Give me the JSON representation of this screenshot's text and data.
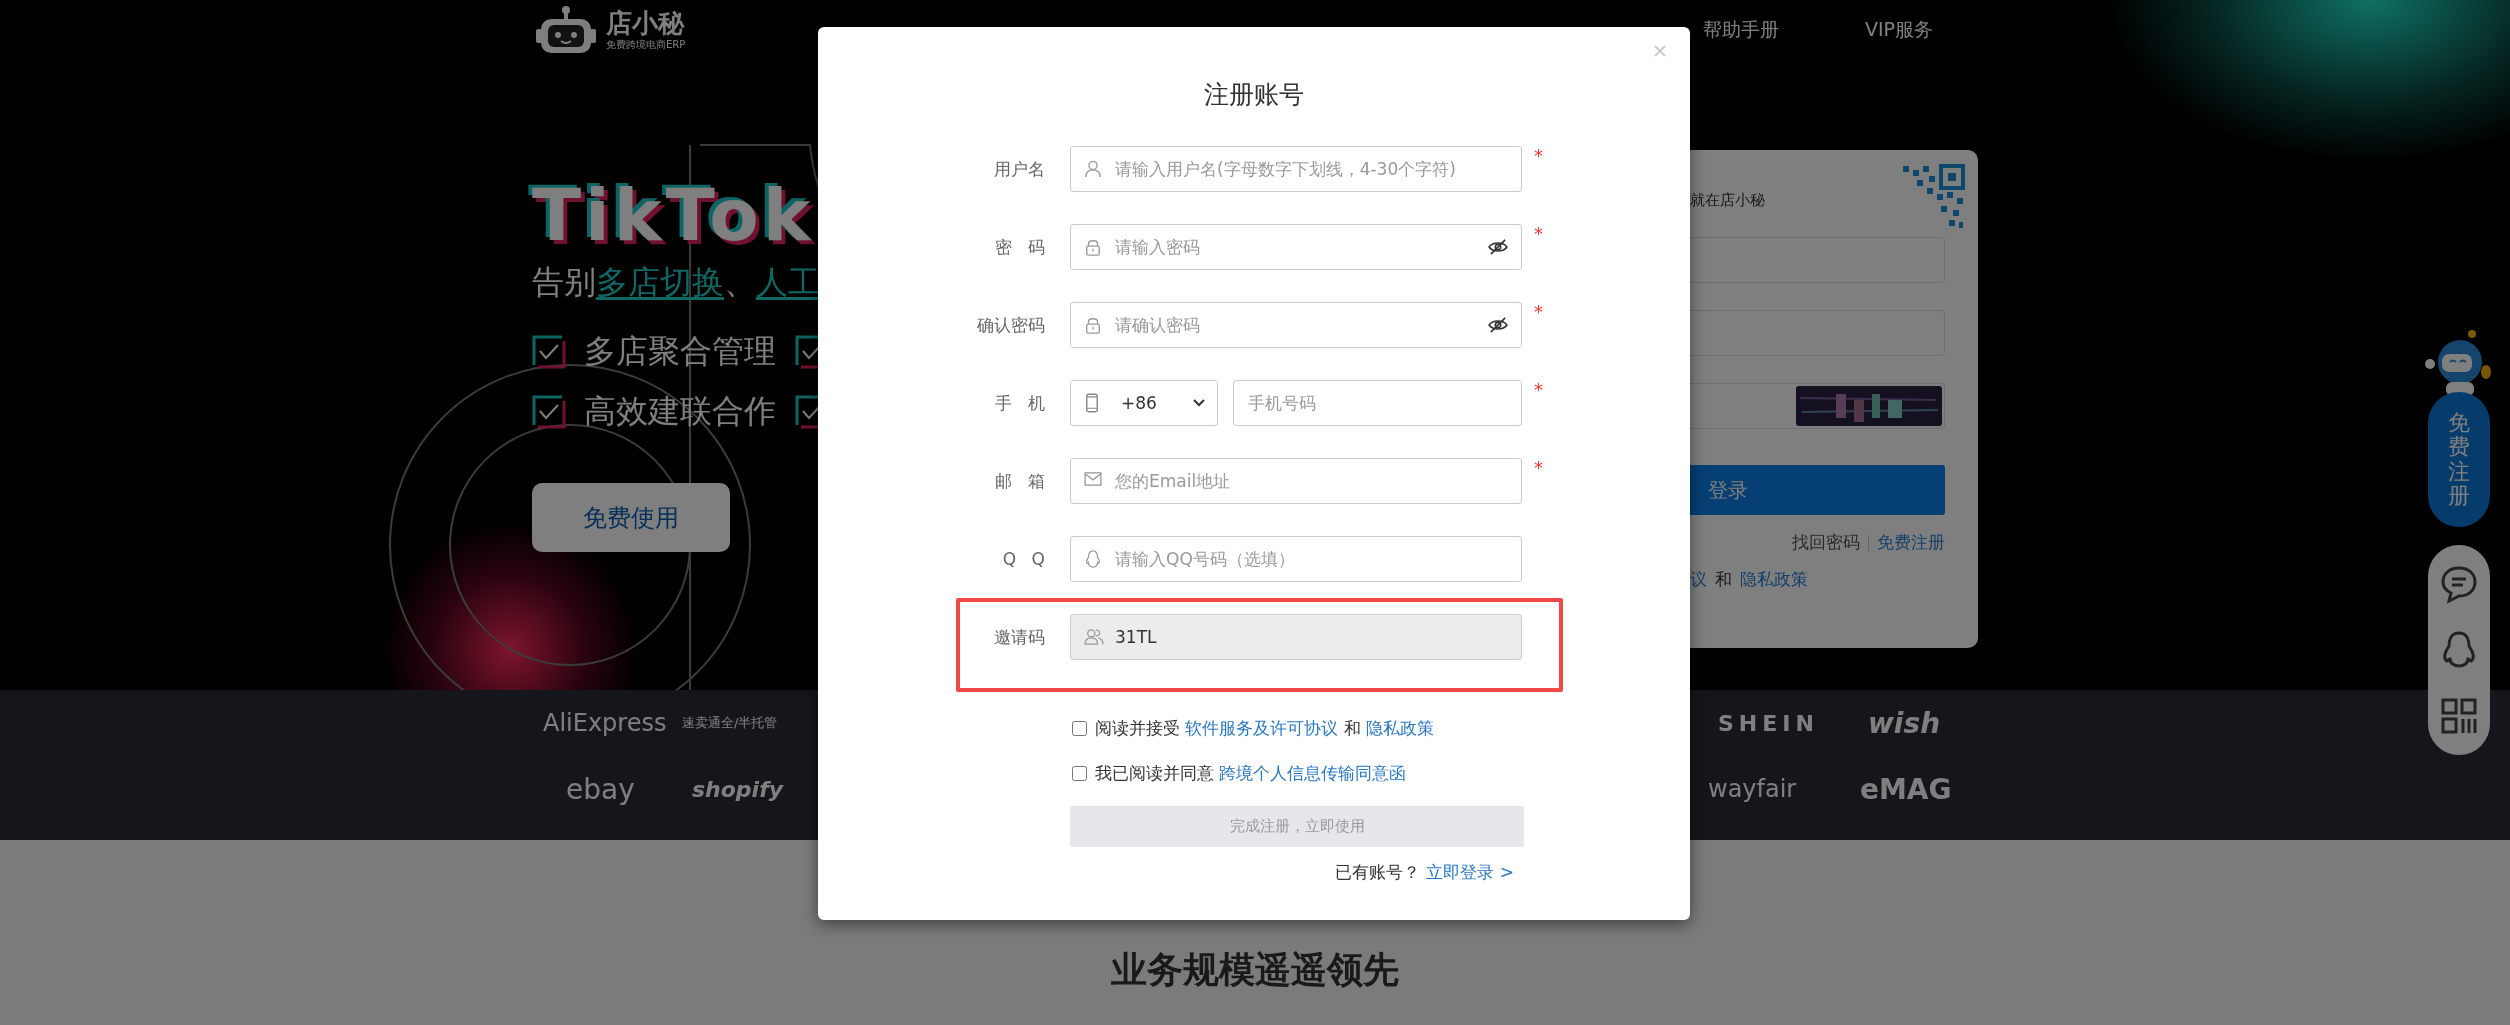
{
  "nav": {
    "logo_text": "店小秘",
    "logo_tagline": "免费跨境电商ERP",
    "items": [
      "帮助手册",
      "VIP服务"
    ]
  },
  "hero": {
    "title": "TikTok",
    "subtitle": [
      {
        "text": "告别",
        "highlight": false
      },
      {
        "text": "多店切换",
        "highlight": true
      },
      {
        "text": "、",
        "highlight": false
      },
      {
        "text": "人工",
        "highlight": true
      }
    ],
    "features": [
      "多店聚合管理",
      "高效建联合作"
    ],
    "cta": "免费使用"
  },
  "login_card": {
    "slogan": "就在店小秘",
    "login_button": "登录",
    "links": [
      "找回密码",
      "免费注册"
    ],
    "agreement": [
      {
        "text": "议",
        "kind": "link"
      },
      {
        "text": "和",
        "kind": "plain"
      },
      {
        "text": "隐私政策",
        "kind": "link"
      }
    ]
  },
  "side_widget": {
    "register": "免费注册"
  },
  "platform_logos": [
    "AliExpress",
    "速卖通全/半托管",
    "SHEIN",
    "wish",
    "ebay",
    "shopify",
    "wayfair",
    "eMAG"
  ],
  "section_title": "业务规模遥遥领先",
  "modal": {
    "title": "注册账号",
    "fields": [
      {
        "label": "用户名",
        "kind": "username",
        "placeholder": "请输入用户名(字母数字下划线，4-30个字符)",
        "required_mark": "*"
      },
      {
        "label": "密 码",
        "kind": "password",
        "placeholder": "请输入密码",
        "required_mark": "*"
      },
      {
        "label": "确认密码",
        "kind": "password",
        "placeholder": "请确认密码",
        "required_mark": "*"
      },
      {
        "label": "手 机",
        "kind": "phone",
        "code": "+86",
        "placeholder": "手机号码",
        "required_mark": "*"
      },
      {
        "label": "邮 箱",
        "kind": "email",
        "placeholder": "您的Email地址",
        "required_mark": "*"
      },
      {
        "label": "Q Q",
        "kind": "qq",
        "placeholder": "请输入QQ号码（选填）"
      },
      {
        "label": "邀请码",
        "kind": "invite",
        "value": "31TL",
        "disabled": true,
        "highlighted": true
      }
    ],
    "agreements": [
      {
        "checked": false,
        "parts": [
          {
            "text": "阅读并接受",
            "kind": "plain"
          },
          {
            "text": "软件服务及许可协议",
            "kind": "link"
          },
          {
            "text": "和",
            "kind": "plain"
          },
          {
            "text": "隐私政策",
            "kind": "link"
          }
        ]
      },
      {
        "checked": false,
        "parts": [
          {
            "text": "我已阅读并同意",
            "kind": "plain"
          },
          {
            "text": "跨境个人信息传输同意函",
            "kind": "link"
          }
        ]
      }
    ],
    "submit": {
      "label": "完成注册，立即使用",
      "disabled": true
    },
    "login_prompt": {
      "text": "已有账号？",
      "link": "立即登录 >"
    }
  }
}
